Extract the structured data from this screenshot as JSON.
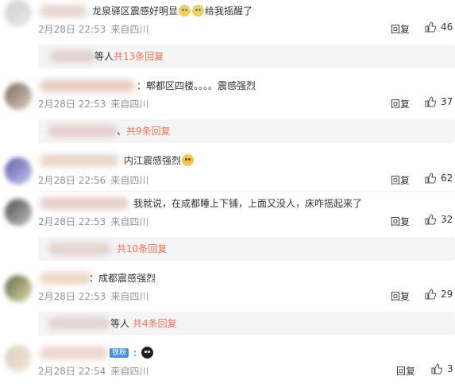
{
  "comments": [
    {
      "text_pre": "龙泉驿区震感好明显",
      "text_post": "给我摇醒了",
      "emojis": [
        "crying-laugh-emoji",
        "crying-laugh-emoji"
      ],
      "date": "2月28日 22:53",
      "location": "来自四川",
      "reply_label": "回复",
      "likes": "46",
      "thread": {
        "prefix": "等人",
        "link": "共13条回复"
      }
    },
    {
      "text": "：郫都区四楼。。。。震感强烈",
      "date": "2月28日 22:53",
      "location": "来自四川",
      "reply_label": "回复",
      "likes": "37",
      "thread": {
        "prefix": "、",
        "link": "共9条回复"
      }
    },
    {
      "text_pre": "内江震感强烈",
      "emojis": [
        "scared-emoji"
      ],
      "date": "2月28日 22:56",
      "location": "来自四川",
      "reply_label": "回复",
      "likes": "62"
    },
    {
      "text": "我就说，在成都睡上下铺，上面又没人，床咋摇起来了",
      "date": "2月28日 22:53",
      "location": "来自四川",
      "reply_label": "回复",
      "likes": "32",
      "thread": {
        "prefix": "",
        "link": "共10条回复"
      }
    },
    {
      "text": "：成都震感强烈",
      "date": "2月28日 22:53",
      "location": "来自四川",
      "reply_label": "回复",
      "likes": "29",
      "thread": {
        "prefix": "等人",
        "link": "共4条回复"
      }
    },
    {
      "badge": "铁粉",
      "emojis": [
        "panda-emoji"
      ],
      "date": "2月28日 22:54",
      "location": "来自四川",
      "reply_label": "回复",
      "likes": "3"
    }
  ],
  "colors": {
    "link": "#eb7350",
    "meta": "#939393",
    "reply_box_bg": "#f5f5f5"
  }
}
